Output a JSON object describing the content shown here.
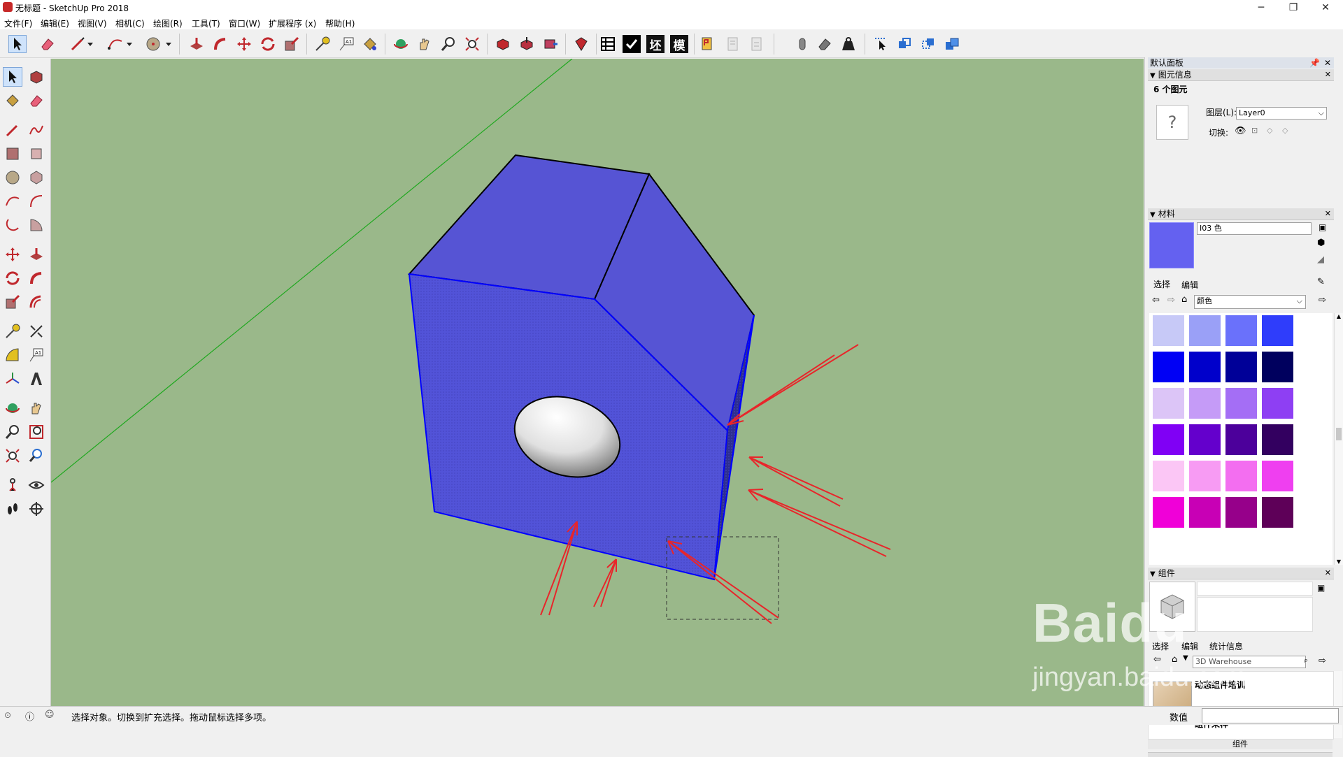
{
  "window": {
    "title": "无标题 - SketchUp Pro 2018",
    "controls": {
      "minimize": "─",
      "maximize": "❐",
      "close": "✕"
    }
  },
  "menu": [
    "文件(F)",
    "编辑(E)",
    "视图(V)",
    "相机(C)",
    "绘图(R)",
    "工具(T)",
    "窗口(W)",
    "扩展程序 (x)",
    "帮助(H)"
  ],
  "toolbar": {
    "text_buttons": [
      "坯",
      "模"
    ]
  },
  "default_tray": {
    "title": "默认面板",
    "entity_info": {
      "header": "图元信息",
      "count": "6 个图元",
      "layer_label": "图层(L):",
      "layer_value": "Layer0",
      "toggle_label": "切换:",
      "unknown_glyph": "?"
    },
    "materials": {
      "header": "材料",
      "current_name": "I03 色",
      "current_color": "#6461f0",
      "tabs": [
        "选择",
        "编辑"
      ],
      "library": "颜色",
      "swatches": [
        "#c7c9f7",
        "#9aa0f7",
        "#6a71fb",
        "#2f3dfb",
        "#0000f5",
        "#0000cb",
        "#000098",
        "#00005e",
        "#dcc5f7",
        "#c59bf7",
        "#a46ef5",
        "#8e3ff3",
        "#8000f5",
        "#6400cc",
        "#4c009b",
        "#330060",
        "#fbc6f5",
        "#f79bf3",
        "#f36ef0",
        "#ef3ff0",
        "#f000d8",
        "#c800b5",
        "#96008a",
        "#5e0058"
      ]
    },
    "components": {
      "header": "组件",
      "tabs": [
        "选择",
        "编辑",
        "统计信息"
      ],
      "search_value": "3D Warehouse",
      "items": [
        "动态组件培训",
        "组件采样"
      ],
      "footer": "组件"
    }
  },
  "status": {
    "message": "选择对象。切换到扩充选择。拖动鼠标选择多项。",
    "measurement_label": "数值"
  },
  "watermark": {
    "text1": "Baidu",
    "text2": "jingyan.baidu.com"
  },
  "colors": {
    "viewport_bg": "#9ab88a",
    "face_front": "#5253d8",
    "face_top": "#5654d4",
    "face_dark": "#2e2f8f",
    "selection_blue": "#0000ff",
    "annotation_red": "#e8252a"
  }
}
